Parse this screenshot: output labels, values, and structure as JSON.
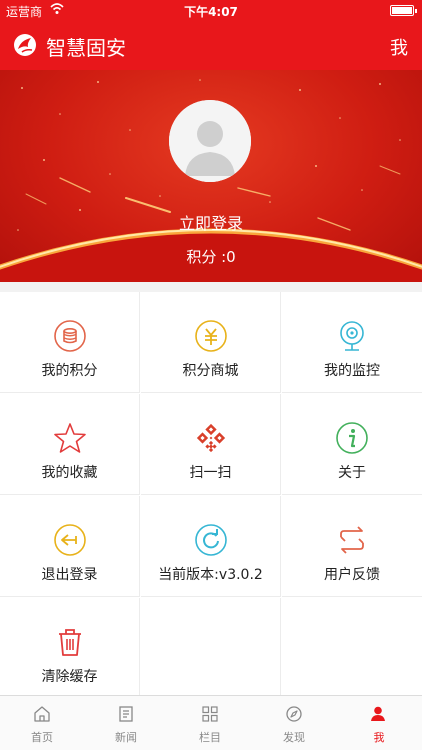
{
  "status_bar": {
    "carrier": "运营商",
    "time": "下午4:07"
  },
  "header": {
    "title": "智慧固安",
    "right_label": "我"
  },
  "profile": {
    "login_text": "立即登录",
    "points_text": "积分 :0"
  },
  "menu": [
    {
      "label": "我的积分",
      "icon": "coins-icon",
      "color": "#e2654a"
    },
    {
      "label": "积分商城",
      "icon": "yuan-coin-icon",
      "color": "#e8b21a"
    },
    {
      "label": "我的监控",
      "icon": "webcam-icon",
      "color": "#36b6d4"
    },
    {
      "label": "我的收藏",
      "icon": "star-icon",
      "color": "#e23c3c"
    },
    {
      "label": "扫一扫",
      "icon": "qrcode-icon",
      "color": "#d9402b"
    },
    {
      "label": "关于",
      "icon": "info-icon",
      "color": "#43b05c"
    },
    {
      "label": "退出登录",
      "icon": "logout-icon",
      "color": "#e8b21a"
    },
    {
      "label": "当前版本:v3.0.2",
      "icon": "refresh-icon",
      "color": "#36b6d4"
    },
    {
      "label": "用户反馈",
      "icon": "feedback-icon",
      "color": "#e2654a"
    },
    {
      "label": "清除缓存",
      "icon": "trash-icon",
      "color": "#e23c3c"
    }
  ],
  "tabs": [
    {
      "label": "首页",
      "icon": "home-icon"
    },
    {
      "label": "新闻",
      "icon": "news-icon"
    },
    {
      "label": "栏目",
      "icon": "grid-icon"
    },
    {
      "label": "发现",
      "icon": "compass-icon"
    },
    {
      "label": "我",
      "icon": "person-icon",
      "active": true
    }
  ],
  "colors": {
    "brand": "#e8171b",
    "tab_active": "#e8171b",
    "tab_inactive": "#888888"
  }
}
